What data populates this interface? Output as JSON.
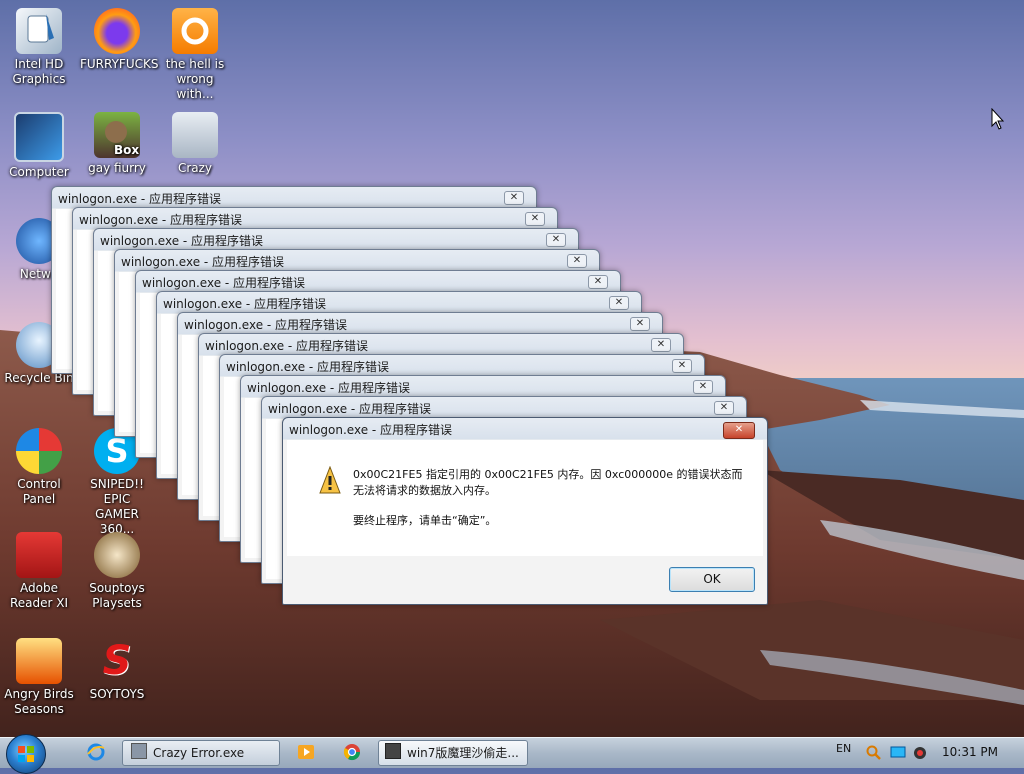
{
  "desktop_icons": [
    {
      "label": "Intel HD Graphics",
      "icon": "intel-graphics-icon"
    },
    {
      "label": "FURRYFUCKS",
      "icon": "firefox-icon"
    },
    {
      "label": "the hell is wrong with...",
      "icon": "uc-browser-icon"
    },
    {
      "label": "Computer",
      "icon": "computer-icon"
    },
    {
      "label": "gay fiurry",
      "icon": "box-game-icon"
    },
    {
      "label": "Crazy",
      "icon": "folder-icon"
    },
    {
      "label": "Netwo",
      "icon": "network-icon"
    },
    {
      "label": "Recycle Bin",
      "icon": "recycle-bin-icon"
    },
    {
      "label": "Control Panel",
      "icon": "control-panel-icon"
    },
    {
      "label": "SNIPED!! EPIC GAMER 360...",
      "icon": "skype-icon"
    },
    {
      "label": "Adobe Reader XI",
      "icon": "adobe-reader-icon"
    },
    {
      "label": "Souptoys Playsets",
      "icon": "souptoys-icon"
    },
    {
      "label": "Angry Birds Seasons",
      "icon": "angry-birds-icon"
    },
    {
      "label": "SOYTOYS",
      "icon": "soytoys-icon"
    }
  ],
  "dialog": {
    "title": "winlogon.exe - 应用程序错误",
    "close": "✕",
    "message_line1": "0x00C21FE5 指定引用的 0x00C21FE5 内存。因 0xc000000e 的错误状态而",
    "message_line2": "无法将请求的数据放入内存。",
    "message_line3": "要终止程序，请单击“确定”。",
    "ok_label": "OK",
    "stacked_count": 11
  },
  "taskbar": {
    "items": [
      {
        "label": "Crazy Error.exe",
        "icon": "crazy-error-icon"
      },
      {
        "label": "win7版魔理沙偷走...",
        "icon": "marisa-icon"
      }
    ],
    "pinned": [
      "ie-icon",
      "media-player-icon",
      "chrome-icon"
    ],
    "language": "EN",
    "clock": "10:31 PM"
  },
  "colors": {
    "dialog_title_bg": "#dfe6ef",
    "close_button_red": "#c6432b",
    "ok_border": "#3c7fb1",
    "taskbar_bg": "#aab9c9"
  }
}
